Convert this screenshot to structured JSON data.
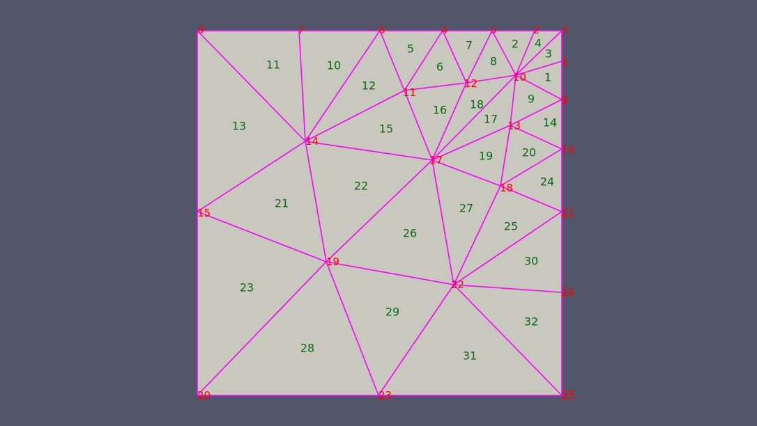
{
  "colors": {
    "background": "#52566b",
    "face": "#c9c8bf",
    "edge": "#ff00ff",
    "node_label": "#ff0000",
    "element_label": "#0b6b12"
  },
  "nodes": [
    {
      "id": "1"
    },
    {
      "id": "2"
    },
    {
      "id": "3"
    },
    {
      "id": "4"
    },
    {
      "id": "5"
    },
    {
      "id": "6"
    },
    {
      "id": "7"
    },
    {
      "id": "8"
    },
    {
      "id": "9"
    },
    {
      "id": "10"
    },
    {
      "id": "11"
    },
    {
      "id": "12"
    },
    {
      "id": "13"
    },
    {
      "id": "14"
    },
    {
      "id": "15"
    },
    {
      "id": "16"
    },
    {
      "id": "17"
    },
    {
      "id": "18"
    },
    {
      "id": "19"
    },
    {
      "id": "20"
    },
    {
      "id": "21"
    },
    {
      "id": "22"
    },
    {
      "id": "23"
    },
    {
      "id": "24"
    },
    {
      "id": "25"
    }
  ],
  "elements": [
    {
      "id": "1",
      "nodes": [
        "1",
        "10",
        "9"
      ]
    },
    {
      "id": "2",
      "nodes": [
        "5",
        "2",
        "10"
      ]
    },
    {
      "id": "3",
      "nodes": [
        "3",
        "1",
        "10"
      ]
    },
    {
      "id": "4",
      "nodes": [
        "2",
        "3",
        "10"
      ]
    },
    {
      "id": "5",
      "nodes": [
        "6",
        "4",
        "11"
      ]
    },
    {
      "id": "6",
      "nodes": [
        "4",
        "12",
        "11"
      ]
    },
    {
      "id": "7",
      "nodes": [
        "4",
        "5",
        "12"
      ]
    },
    {
      "id": "8",
      "nodes": [
        "5",
        "10",
        "12"
      ]
    },
    {
      "id": "9",
      "nodes": [
        "10",
        "9",
        "13"
      ]
    },
    {
      "id": "10",
      "nodes": [
        "7",
        "6",
        "14"
      ]
    },
    {
      "id": "11",
      "nodes": [
        "8",
        "7",
        "14"
      ]
    },
    {
      "id": "12",
      "nodes": [
        "6",
        "11",
        "14"
      ]
    },
    {
      "id": "13",
      "nodes": [
        "8",
        "14",
        "15"
      ]
    },
    {
      "id": "14",
      "nodes": [
        "9",
        "16",
        "13"
      ]
    },
    {
      "id": "15",
      "nodes": [
        "14",
        "11",
        "17"
      ]
    },
    {
      "id": "16",
      "nodes": [
        "11",
        "12",
        "17"
      ]
    },
    {
      "id": "17",
      "nodes": [
        "10",
        "13",
        "17"
      ]
    },
    {
      "id": "18",
      "nodes": [
        "12",
        "10",
        "17"
      ]
    },
    {
      "id": "19",
      "nodes": [
        "13",
        "18",
        "17"
      ]
    },
    {
      "id": "20",
      "nodes": [
        "13",
        "16",
        "18"
      ]
    },
    {
      "id": "21",
      "nodes": [
        "14",
        "19",
        "15"
      ]
    },
    {
      "id": "22",
      "nodes": [
        "14",
        "17",
        "19"
      ]
    },
    {
      "id": "23",
      "nodes": [
        "15",
        "19",
        "20"
      ]
    },
    {
      "id": "24",
      "nodes": [
        "16",
        "21",
        "18"
      ]
    },
    {
      "id": "25",
      "nodes": [
        "18",
        "21",
        "22"
      ]
    },
    {
      "id": "26",
      "nodes": [
        "17",
        "22",
        "19"
      ]
    },
    {
      "id": "27",
      "nodes": [
        "17",
        "18",
        "22"
      ]
    },
    {
      "id": "28",
      "nodes": [
        "19",
        "23",
        "20"
      ]
    },
    {
      "id": "29",
      "nodes": [
        "19",
        "22",
        "23"
      ]
    },
    {
      "id": "30",
      "nodes": [
        "21",
        "24",
        "22"
      ]
    },
    {
      "id": "31",
      "nodes": [
        "22",
        "25",
        "23"
      ]
    },
    {
      "id": "32",
      "nodes": [
        "22",
        "24",
        "25"
      ]
    }
  ]
}
